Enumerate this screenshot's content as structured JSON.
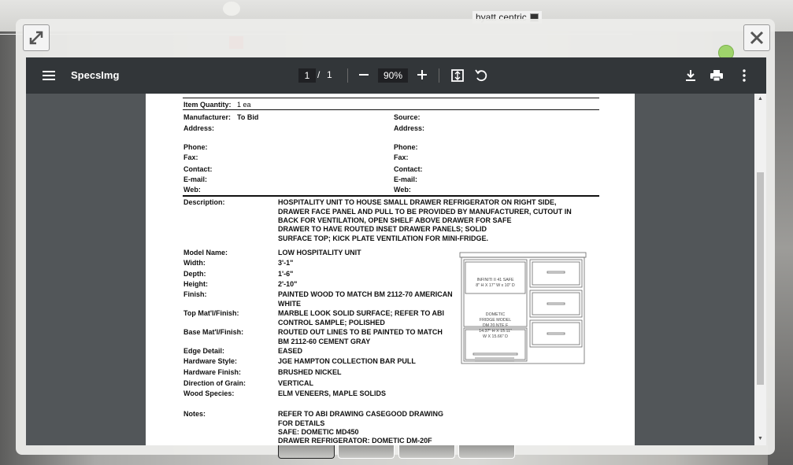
{
  "background": {
    "hotel_label": "hyatt centric"
  },
  "modal": {
    "expand_icon": "expand-arrows-icon",
    "close_icon": "close-x-icon"
  },
  "toolbar": {
    "title": "SpecsImg",
    "page_current": "1",
    "page_separator": "/",
    "page_total": "1",
    "zoom": "90%"
  },
  "spec": {
    "item_quantity_label": "Item Quantity:",
    "item_quantity_value": "1 ea",
    "manufacturer_label": "Manufacturer:",
    "manufacturer_value": "To Bid",
    "source_label": "Source:",
    "address_label": "Address:",
    "phone_label": "Phone:",
    "fax_label": "Fax:",
    "contact_label": "Contact:",
    "email_label": "E-mail:",
    "web_label": "Web:",
    "description_label": "Description:",
    "description_p1": "HOSPITALITY UNIT TO HOUSE SMALL DRAWER REFRIGERATOR ON RIGHT SIDE, DRAWER FACE PANEL AND PULL TO BE PROVIDED BY MANUFACTURER, CUTOUT IN BACK FOR VENTILATION, OPEN SHELF ABOVE DRAWER FOR SAFE",
    "description_p2": "DRAWER TO HAVE ROUTED INSET DRAWER PANELS; SOLID SURFACE TOP; KICK PLATE VENTILATION FOR MINI-FRIDGE.",
    "fields": [
      {
        "label": "Model Name:",
        "value": "LOW HOSPITALITY UNIT"
      },
      {
        "label": "Width:",
        "value": "3'-1\""
      },
      {
        "label": "Depth:",
        "value": "1'-6\""
      },
      {
        "label": "Height:",
        "value": "2'-10\""
      },
      {
        "label": "Finish:",
        "value": "PAINTED WOOD TO MATCH BM 2112-70 AMERICAN WHITE"
      },
      {
        "label": "Top Mat'l/Finish:",
        "value": "MARBLE LOOK SOLID SURFACE; REFER TO ABI CONTROL SAMPLE; POLISHED"
      },
      {
        "label": "Base Mat'l/Finish:",
        "value": "ROUTED OUT LINES TO BE PAINTED TO MATCH BM 2112-60 CEMENT GRAY"
      },
      {
        "label": "Edge Detail:",
        "value": "EASED"
      },
      {
        "label": "Hardware Style:",
        "value": "JGE HAMPTON COLLECTION BAR PULL"
      },
      {
        "label": "Hardware Finish:",
        "value": "BRUSHED NICKEL"
      },
      {
        "label": "Direction of Grain:",
        "value": "VERTICAL"
      },
      {
        "label": "Wood Species:",
        "value": "ELM VENEERS, MAPLE SOLIDS"
      }
    ],
    "notes_label": "Notes:",
    "notes_line1": "REFER TO ABI DRAWING CASEGOOD DRAWING FOR DETAILS",
    "notes_line2": "SAFE: DOMETIC MD450",
    "notes_line3": "DRAWER REFRIGERATOR: DOMETIC DM-20F",
    "drawing_safe_line1": "INFINITI II 41 SAFE",
    "drawing_safe_line2": "8\" H X 17\" W x 10\" D",
    "drawing_fridge_line1": "DOMETIC",
    "drawing_fridge_line2": "FRIDGE MODEL",
    "drawing_fridge_line3": "DM 20 NTE F",
    "drawing_fridge_line4": "14.37\" H X 15.11\"",
    "drawing_fridge_line5": "W X 15.66\" D"
  },
  "thumbnails": [
    {
      "active": true
    },
    {
      "active": false
    },
    {
      "active": false
    },
    {
      "active": false
    }
  ]
}
